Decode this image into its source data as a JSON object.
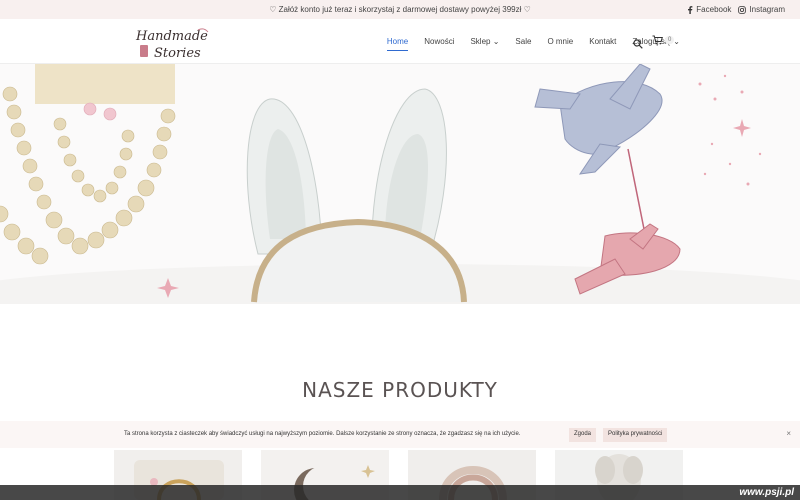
{
  "topbar": {
    "promo": "♡ Załóż konto już teraz i skorzystaj z darmowej dostawy powyżej 399zł ♡",
    "social": [
      {
        "label": "Facebook",
        "icon": "facebook-icon"
      },
      {
        "label": "Instagram",
        "icon": "instagram-icon"
      }
    ]
  },
  "header": {
    "logo_text_1": "Handmade",
    "logo_text_2": "Stories",
    "nav": [
      {
        "label": "Home",
        "active": true
      },
      {
        "label": "Nowości"
      },
      {
        "label": "Sklep",
        "dropdown": true
      },
      {
        "label": "Sale"
      },
      {
        "label": "O mnie"
      },
      {
        "label": "Kontakt"
      },
      {
        "label": "Zaloguj się",
        "dropdown": true
      }
    ],
    "cart_count": "0"
  },
  "section": {
    "title": "NASZE PRODUKTY"
  },
  "cookie": {
    "message": "Ta strona korzysta z ciasteczek aby świadczyć usługi na najwyższym poziomie. Dalsze korzystanie ze strony oznacza, że zgadzasz się na ich użycie.",
    "accept": "Zgoda",
    "policy": "Polityka prywatności",
    "close": "×"
  },
  "watermark": "www.psji.pl",
  "colors": {
    "accent": "#2f6ad0",
    "topbar_bg": "#f8f0ef",
    "cookie_btn": "#f2e3e0"
  }
}
